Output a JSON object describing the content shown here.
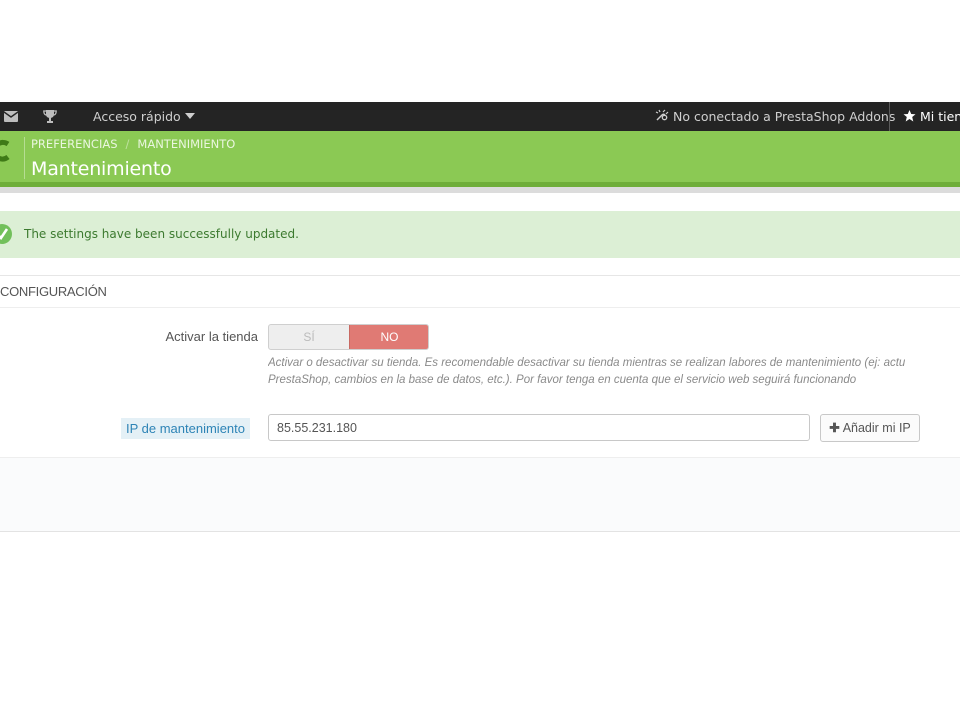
{
  "topbar": {
    "quick_access_label": "Acceso rápido",
    "addons_status": "No conectado a PrestaShop Addons",
    "store_label": "Mi tienda",
    "icons": [
      "envelope-icon",
      "trophy-icon",
      "addons-unplug-icon",
      "star-icon"
    ]
  },
  "header": {
    "breadcrumb": [
      "PREFERENCIAS",
      "MANTENIMIENTO"
    ],
    "title": "Mantenimiento",
    "accent_color": "#8bc954"
  },
  "alert": {
    "message": "The settings have been successfully updated.",
    "type": "success"
  },
  "panel": {
    "heading": "CONFIGURACIÓN",
    "shop_toggle": {
      "label": "Activar la tienda",
      "yes_label": "SÍ",
      "no_label": "NO",
      "selected": "NO",
      "help_line1": "Activar o desactivar su tienda. Es recomendable desactivar su tienda mientras se realizan labores de mantenimiento (ej: actu",
      "help_line2": "PrestaShop, cambios en la base de datos, etc.). Por favor tenga en cuenta que el servicio web seguirá funcionando"
    },
    "maintenance_ip": {
      "label": "IP de mantenimiento",
      "value": "85.55.231.180",
      "add_button_label": "Añadir mi IP"
    }
  }
}
